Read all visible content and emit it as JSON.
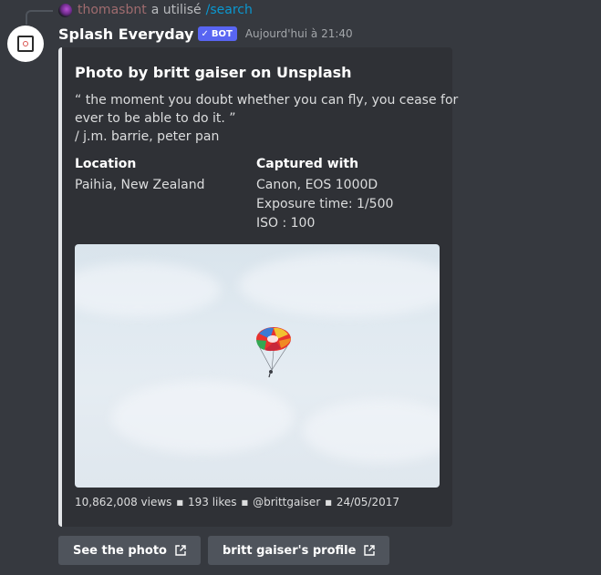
{
  "reply": {
    "user": "thomasbnt",
    "text": "a utilisé",
    "command": "/search"
  },
  "message": {
    "author": "Splash Everyday",
    "badge": "BOT",
    "timestamp": "Aujourd'hui à 21:40"
  },
  "embed": {
    "accent_color": "#e3e5e8",
    "title": "Photo by britt gaiser on Unsplash",
    "description_lines": [
      "“ the moment you doubt whether you can fly, you cease for",
      "ever to be able to do it. ”",
      "/ j.m. barrie, peter pan"
    ],
    "fields": {
      "location": {
        "name": "Location",
        "values": [
          "Paihia, New Zealand"
        ]
      },
      "captured": {
        "name": "Captured with",
        "values": [
          "Canon, EOS 1000D",
          "Exposure time: 1/500",
          "ISO : 100"
        ]
      }
    },
    "image_icon": "parasail-photo",
    "footer": {
      "views": "10,862,008 views",
      "likes": "193 likes",
      "handle": "@brittgaiser",
      "date": "24/05/2017"
    }
  },
  "buttons": {
    "see_photo": "See the photo",
    "profile": "britt gaiser's profile"
  }
}
